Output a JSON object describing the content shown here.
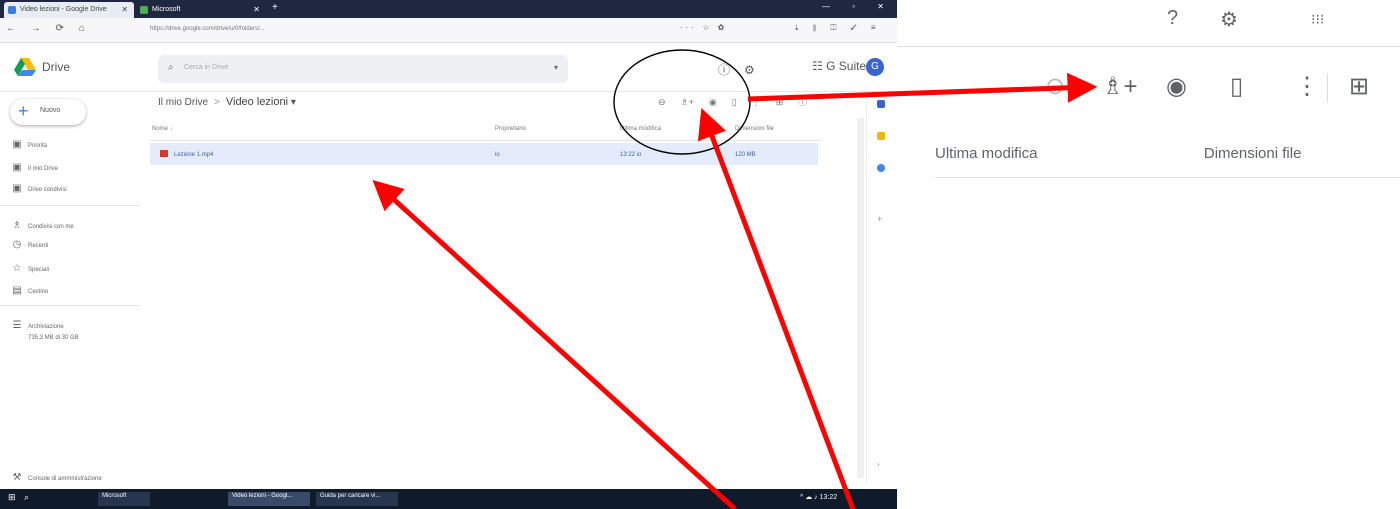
{
  "browser": {
    "tabs": [
      {
        "label": "Video lezioni - Google Drive"
      },
      {
        "label": "Microsoft"
      }
    ],
    "new_tab": "+",
    "window_controls": "— ▫ ✕",
    "nav": "← → ⟳ ⌂",
    "url": "https://drive.google.com/drive/u/0/folders/...",
    "url_actions": "··· ☆ ✿",
    "extensions": "⤓ ⫴ ◫ ✓ ≡"
  },
  "drive": {
    "app_name": "Drive",
    "search_placeholder": "Cerca in Drive",
    "gsuite_label": "G Suite",
    "avatar_letter": "G",
    "new_button": "Nuovo",
    "sidebar": [
      {
        "icon": "▣",
        "label": "Priorità"
      },
      {
        "icon": "▣",
        "label": "Il mio Drive"
      },
      {
        "icon": "▣",
        "label": "Drive condivisi"
      },
      {
        "icon": "♗",
        "label": "Condivisi con me"
      },
      {
        "icon": "◷",
        "label": "Recenti"
      },
      {
        "icon": "☆",
        "label": "Speciali"
      },
      {
        "icon": "▤",
        "label": "Cestino"
      },
      {
        "icon": "☰",
        "label": "Archiviazione"
      },
      {
        "icon": "",
        "label": "735,3 MB di 30 GB"
      }
    ],
    "footer_item": "Console di amministrazione",
    "breadcrumb": {
      "root": "Il mio Drive",
      "separator": ">",
      "current": "Video lezioni",
      "caret": "▾"
    },
    "toolbar_icons": [
      "⊖",
      "♗+",
      "◉",
      "▯",
      "⋮",
      "⊞",
      "ⓘ"
    ],
    "columns": {
      "name": "Nome ↓",
      "owner": "Proprietario",
      "modified": "Ultima modifica",
      "size": "Dimensioni file"
    },
    "file": {
      "name": "Lezione 1.mp4",
      "owner": "io",
      "modified": "13:22 io",
      "size": "120 MB"
    }
  },
  "taskbar": {
    "start": "⊞",
    "search": "⌕",
    "items": [
      "Microsoft",
      "Video lezioni - Googl...",
      "Guida per caricare vi..."
    ],
    "tray": "^ ☁ ♪ 13:22"
  },
  "zoom": {
    "top_icons": [
      "?",
      "⚙",
      "⁝⁝⁝"
    ],
    "toolbar_icons": [
      "⊖",
      "♗+",
      "◉",
      "▯",
      "⋮",
      "⊞"
    ],
    "col_modified": "Ultima modifica",
    "col_size": "Dimensioni file"
  },
  "colors": {
    "arrow": "#ff0000",
    "selection": "#e4ecfb",
    "gsuite_blue": "#3b63d0"
  }
}
